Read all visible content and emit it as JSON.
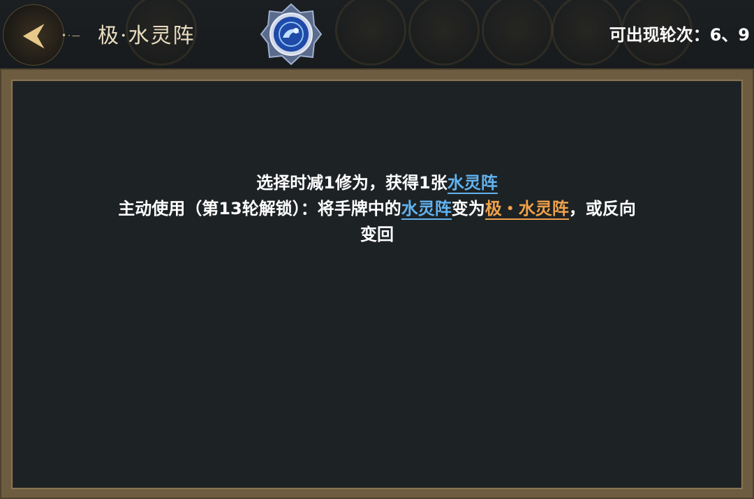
{
  "header": {
    "back_icon_glyph": "⮜",
    "title": "极·水灵阵",
    "rounds_label": "可出现轮次：6、9"
  },
  "description": {
    "line1_prefix": "选择时减1修为，获得1张",
    "line1_keyword": "水灵阵",
    "line2_prefix": "主动使用（第13轮解锁）：将手牌中的",
    "line2_keyword1": "水灵阵",
    "line2_mid": "变为",
    "line2_keyword2": "极・水灵阵",
    "line2_suffix": "，或反向",
    "line3": "变回"
  },
  "colors": {
    "keyword_blue": "#62b3f0",
    "keyword_orange": "#f0a24a",
    "frame_gold": "#8a7654"
  },
  "icons": {
    "back": "back-arrow-icon",
    "emblem": "water-spirit-array-emblem-icon"
  }
}
